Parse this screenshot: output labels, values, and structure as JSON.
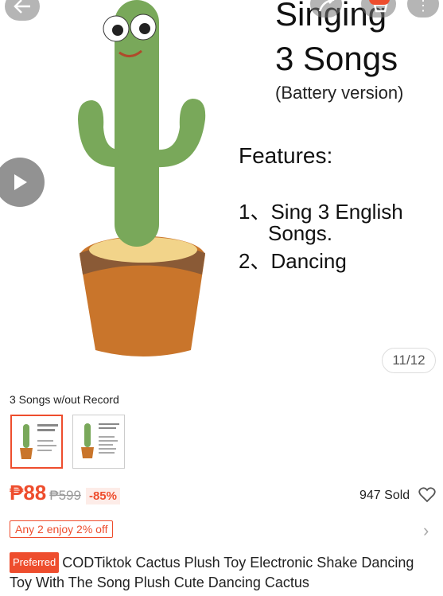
{
  "hero": {
    "title_line1": "Singing",
    "title_line2": "3 Songs",
    "subtitle": "(Battery version)",
    "features_heading": "Features:",
    "feature1_a": "1、Sing 3 English",
    "feature1_b": "Songs.",
    "feature2": "2、Dancing",
    "counter": "11/12"
  },
  "variation": {
    "label": "3 Songs w/out Record",
    "thumb1_text": "Singing 3 Songs",
    "thumb2_text": "Singing 3 Songs"
  },
  "price": {
    "current": "₱88",
    "original": "₱599",
    "discount": "-85%",
    "sold": "947 Sold"
  },
  "promo": {
    "label": "Any 2 enjoy 2% off"
  },
  "product": {
    "badge": "Preferred",
    "title": "CODTiktok Cactus Plush Toy Electronic Shake Dancing Toy With The Song Plush Cute Dancing Cactus"
  },
  "colors": {
    "accent": "#ee4d2d"
  },
  "icons": [
    "back-arrow-icon",
    "share-icon",
    "cart-icon",
    "more-icon",
    "play-icon",
    "heart-icon",
    "chevron-right-icon"
  ]
}
